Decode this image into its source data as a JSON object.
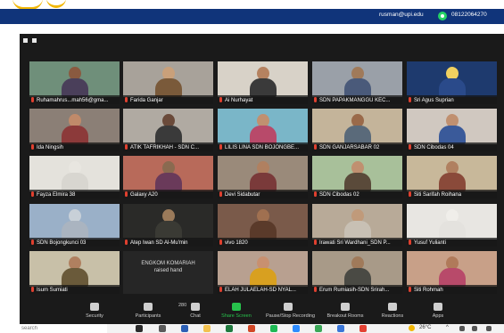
{
  "header": {
    "email": "rusman@upi.edu",
    "phone": "08122064270",
    "whatsapp_color": "#25d366",
    "bar_color": "#10347a"
  },
  "participants": [
    {
      "name": "Ruhamahrus...mah56@gma...",
      "scene": "#6f8f7a",
      "head": "#8a5a40",
      "body": "#4a3f5a"
    },
    {
      "name": "Farida Ganjar",
      "scene": "#a8a29a",
      "head": "#c9a07a",
      "body": "#7a5a3a"
    },
    {
      "name": "Ai Nurhayat",
      "scene": "#d8d2c8",
      "head": "#b58260",
      "body": "#3a3a3a"
    },
    {
      "name": "SDN PAPAKMANGGU KEC...",
      "scene": "#9aa0a8",
      "head": "#a07a5a",
      "body": "#4a5a7a"
    },
    {
      "name": "Sri Agus Suprian",
      "scene": "#1e3a6e",
      "head": "#f0d060",
      "body": "#2a4a8a"
    },
    {
      "name": "Ida Ningsih",
      "scene": "#8b7f76",
      "head": "#c08a6a",
      "body": "#8c3a3a"
    },
    {
      "name": "ATIK TAFRIKHAH - SDN C...",
      "scene": "#b0aaa2",
      "head": "#6a4a3a",
      "body": "#3a3a3a"
    },
    {
      "name": "LILIS LINA SDN BOJONGBE...",
      "scene": "#7ab6c8",
      "head": "#c09070",
      "body": "#b84a6a"
    },
    {
      "name": "SDN GANJARSABAR 02",
      "scene": "#c4b49a",
      "head": "#9a6a4a",
      "body": "#5a6a7a"
    },
    {
      "name": "SDN Cibodas 04",
      "scene": "#d0c8c0",
      "head": "#c09070",
      "body": "#3a5a9a"
    },
    {
      "name": "Fayza Elmira 38",
      "scene": "#e4e2dc",
      "head": "#e8e6e0",
      "body": "#d8d6d0"
    },
    {
      "name": "Galaxy A20",
      "scene": "#b86a5a",
      "head": "#8a6a50",
      "body": "#6a3a5a"
    },
    {
      "name": "Devi Sidabutar",
      "scene": "#9a8a7a",
      "head": "#b08060",
      "body": "#7a3a3a"
    },
    {
      "name": "SDN Cibodas 02",
      "scene": "#a8c09a",
      "head": "#c09070",
      "body": "#5a4a3a"
    },
    {
      "name": "Siti Sarifah Roihana",
      "scene": "#c8b89a",
      "head": "#b08060",
      "body": "#8a4a3a"
    },
    {
      "name": "SDN Bojongkunci 03",
      "scene": "#9ab0c8",
      "head": "#c8d0d8",
      "body": "#aab4c0"
    },
    {
      "name": "Atep Iwan SD Al-Mu'min",
      "scene": "#2a2a28",
      "head": "#9a7a5a",
      "body": "#3a3a34"
    },
    {
      "name": "vivo 1820",
      "scene": "#7a5a4a",
      "head": "#a07050",
      "body": "#5a3a2a"
    },
    {
      "name": "Irawati Sri Wardhani_SDN P...",
      "scene": "#b8aa98",
      "head": "#c09a7a",
      "body": "#c8c0b4"
    },
    {
      "name": "Yusuf Yulianti",
      "scene": "#e8e6e2",
      "head": "#f0eeea",
      "body": "#e4e2de"
    },
    {
      "name": "Isum Sumiati",
      "scene": "#c8c0a8",
      "head": "#b08060",
      "body": "#6a5a3a"
    },
    {
      "name": "ENGKOM KOMARIAH",
      "scene": "#262626",
      "head": "#262626",
      "body": "#262626",
      "raised": "raised hand"
    },
    {
      "name": "ELAH JULAELAH-SD NYAL...",
      "scene": "#b8a090",
      "head": "#c89070",
      "body": "#d8a020"
    },
    {
      "name": "Erum Rumiasih-SDN Srirah...",
      "scene": "#a89a88",
      "head": "#a07a5a",
      "body": "#4a4a44"
    },
    {
      "name": "Siti Rohmah",
      "scene": "#c8a088",
      "head": "#b07a5a",
      "body": "#b84a6a"
    }
  ],
  "toolbar": {
    "participants_count": "280",
    "buttons": [
      {
        "label": "Security",
        "icon": "shield-icon"
      },
      {
        "label": "Participants",
        "icon": "people-icon"
      },
      {
        "label": "Chat",
        "icon": "chat-icon"
      },
      {
        "label": "Share Screen",
        "icon": "share-screen-icon"
      },
      {
        "label": "Pause/Stop Recording",
        "icon": "recording-icon"
      },
      {
        "label": "Breakout Rooms",
        "icon": "breakout-rooms-icon"
      },
      {
        "label": "Reactions",
        "icon": "reactions-icon"
      },
      {
        "label": "Apps",
        "icon": "apps-icon"
      }
    ],
    "share_color": "#27c24c"
  },
  "taskbar": {
    "search_placeholder": "search",
    "temperature": "26°C"
  }
}
